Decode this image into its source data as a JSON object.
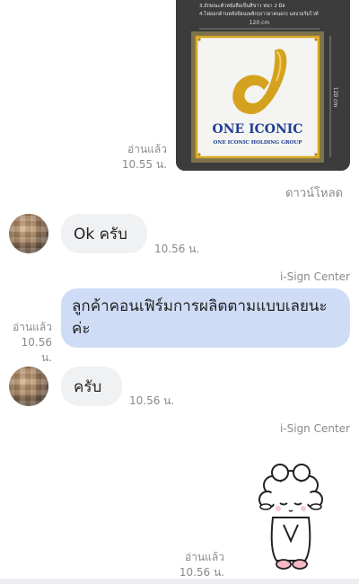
{
  "messages": {
    "image_msg": {
      "read_label": "อ่านแล้ว",
      "time": "10.55 น.",
      "download_label": "ดาวน์โหลด",
      "image": {
        "spec_line_1": "3.ถักษณะตัวหนังสือเป็นสีขาว หนา 2 มิล",
        "spec_line_2": "4.ไฟออกด้านหลังป้อนเพลิก(ยาวอาคนอก) แสงวอร์มไวท์",
        "width_dim": "120 cm",
        "height_dim": "120 cm",
        "logo_title": "ONE ICONIC",
        "logo_subtitle": "ONE ICONIC HOLDING GROUP"
      }
    },
    "msg_ok": {
      "text": "Ok ครับ",
      "time": "10.56 น."
    },
    "sender_name_1": "i-Sign Center",
    "msg_confirm": {
      "text": "ลูกค้าคอนเฟิร์มการผลิตตามแบบเลยนะค่ะ",
      "read_label": "อ่านแล้ว",
      "time": "10.56 น."
    },
    "msg_krub": {
      "text": "ครับ",
      "time": "10.56 น."
    },
    "sender_name_2": "i-Sign Center",
    "sticker_msg": {
      "read_label": "อ่านแล้ว",
      "time": "10.56 น.",
      "sticker": "bowing-sheep-sticker"
    }
  },
  "colors": {
    "incoming_bubble": "#f0f1f3",
    "outgoing_bubble": "#cfdcf6",
    "meta_text": "#8a8a8a",
    "gold": "#d9a824",
    "logo_blue": "#1f3e93"
  }
}
